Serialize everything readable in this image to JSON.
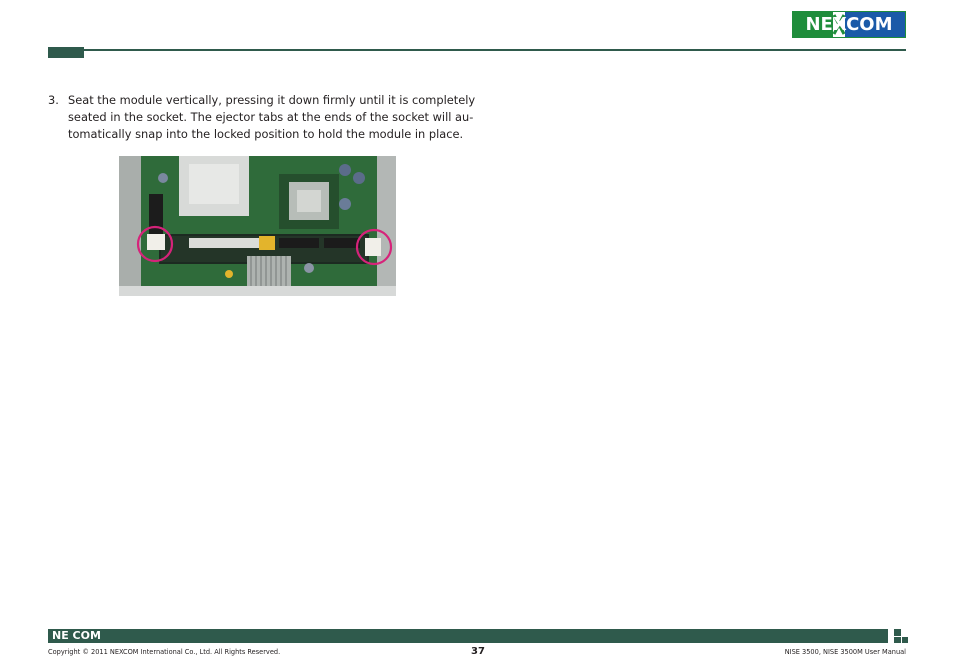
{
  "header": {
    "logo_text": "NEXCOM",
    "colors": {
      "brand_green": "#1f8d3b",
      "brand_blue": "#1a5aa8",
      "rule": "#2f5a4c"
    }
  },
  "content": {
    "step_number": "3.",
    "step_lines": [
      "Seat the module vertically, pressing it down firmly until it is completely",
      "seated in the socket. The ejector tabs at the ends of the socket will au-",
      "tomatically snap into the locked position to hold the module in place."
    ]
  },
  "figure": {
    "subject": "memory module seated in SO-DIMM socket on motherboard",
    "callout_color": "#d6237a"
  },
  "footer": {
    "logo_text": "NE COM",
    "copyright": "Copyright © 2011 NEXCOM International Co., Ltd. All Rights Reserved.",
    "page_number": "37",
    "manual_title": "NISE 3500, NISE 3500M User Manual"
  }
}
